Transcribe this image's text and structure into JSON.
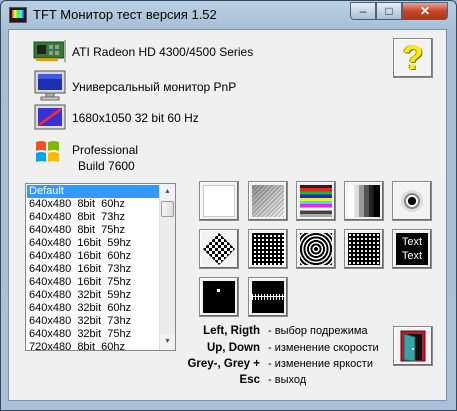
{
  "window": {
    "title": "TFT Монитор тест версия 1.52",
    "min_label": "–",
    "max_label": "□",
    "close_label": "✕"
  },
  "info": {
    "gpu": "ATI Radeon HD 4300/4500 Series",
    "monitor": "Универсальный монитор PnP",
    "resolution": "1680x1050 32 bit 60 Hz",
    "os_edition": "Professional",
    "os_build": "Build 7600"
  },
  "help_label": "?",
  "modes": {
    "items": [
      "Default",
      "640x480  8bit  60hz",
      "640x480  8bit  73hz",
      "640x480  8bit  75hz",
      "640x480  16bit  59hz",
      "640x480  16bit  60hz",
      "640x480  16bit  73hz",
      "640x480  16bit  75hz",
      "640x480  32bit  59hz",
      "640x480  32bit  60hz",
      "640x480  32bit  73hz",
      "640x480  32bit  75hz",
      "720x480  8bit  60hz"
    ],
    "selected_index": 0
  },
  "text_test": {
    "line1": "Text",
    "line2": "Text"
  },
  "hotkeys": [
    {
      "key": "Left, Rigth",
      "desc": "- выбор подрежима"
    },
    {
      "key": "Up, Down",
      "desc": "- изменение скорости"
    },
    {
      "key": "Grey-, Grey +",
      "desc": "- изменение яркости"
    },
    {
      "key": "Esc",
      "desc": "- выход"
    }
  ],
  "colors": {
    "selection": "#3399ff",
    "close_button": "#c8452a",
    "help_mark": "#f5ea12"
  },
  "icons": {
    "gpu": "graphics-card-icon",
    "monitor": "monitor-icon",
    "display_mode": "display-settings-icon",
    "os": "windows-logo-icon",
    "exit": "exit-door-icon"
  }
}
